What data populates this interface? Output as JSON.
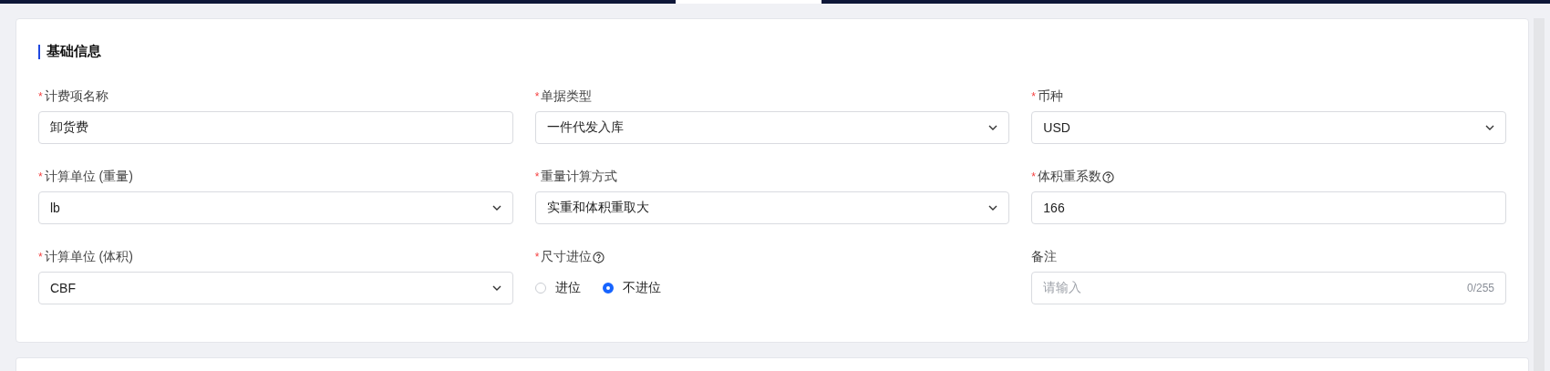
{
  "section": {
    "title": "基础信息"
  },
  "fields": [
    {
      "kind": "text",
      "mark": "*",
      "label": "计费项名称",
      "help": false,
      "value": "卸货费"
    },
    {
      "kind": "select",
      "mark": "*",
      "label": "单据类型",
      "help": false,
      "value": "一件代发入库"
    },
    {
      "kind": "select",
      "mark": "*",
      "label": "币种",
      "help": false,
      "value": "USD"
    },
    {
      "kind": "select",
      "mark": "*",
      "label": "计算单位 (重量)",
      "help": false,
      "value": "lb"
    },
    {
      "kind": "select",
      "mark": "*",
      "label": "重量计算方式",
      "help": false,
      "value": "实重和体积重取大"
    },
    {
      "kind": "text",
      "mark": "*",
      "label": "体积重系数",
      "help": true,
      "value": "166"
    },
    {
      "kind": "select",
      "mark": "*",
      "label": "计算单位 (体积)",
      "help": false,
      "value": "CBF"
    },
    {
      "kind": "radio",
      "mark": "*",
      "label": "尺寸进位",
      "help": true,
      "options": [
        {
          "label": "进位",
          "selected": false
        },
        {
          "label": "不进位",
          "selected": true
        }
      ]
    },
    {
      "kind": "counter",
      "label": "备注",
      "help": false,
      "placeholder": "请输入",
      "count": "0/255"
    }
  ]
}
